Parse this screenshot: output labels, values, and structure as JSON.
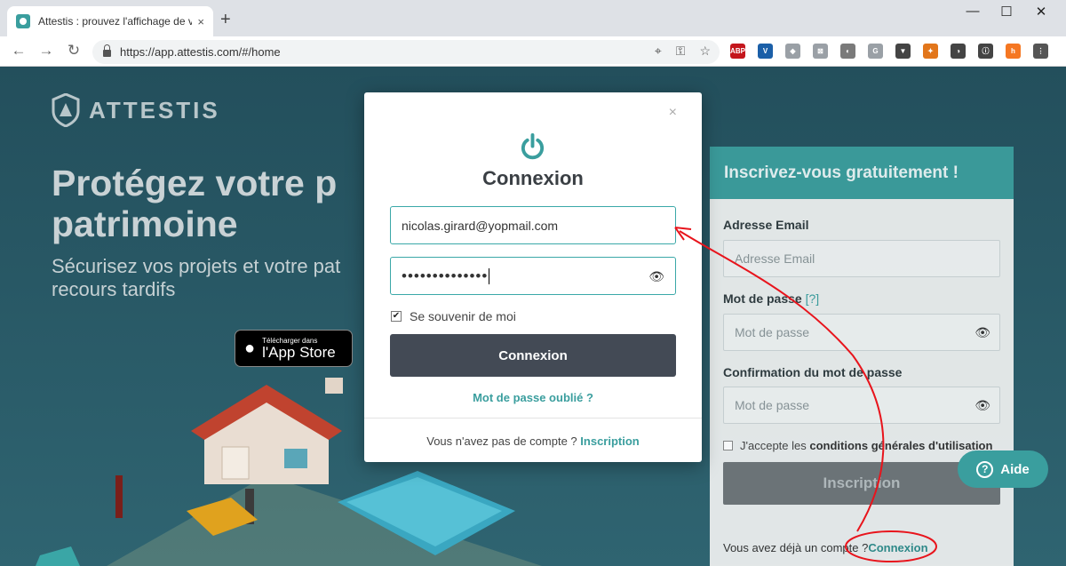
{
  "browser": {
    "tab_title": "Attestis : prouvez l'affichage de v",
    "tab_close": "×",
    "new_tab": "+",
    "url": "https://app.attestis.com/#/home",
    "window_controls": {
      "minimize": "—",
      "maximize": "☐",
      "close": "✕"
    },
    "nav": {
      "back": "←",
      "forward": "→",
      "reload": "↻"
    },
    "extensions": [
      {
        "label": "ABP",
        "color": "#c4161c"
      },
      {
        "label": "V",
        "color": "#1b5fa8"
      },
      {
        "label": "◆",
        "color": "#9aa0a6"
      },
      {
        "label": "⊠",
        "color": "#9aa0a6"
      },
      {
        "label": "◐",
        "color": "#7a7a7a"
      },
      {
        "label": "G",
        "color": "#9aa0a6"
      },
      {
        "label": "▼",
        "color": "#444444"
      },
      {
        "label": "✦",
        "color": "#e2761b"
      },
      {
        "label": "◑",
        "color": "#444444"
      },
      {
        "label": "ⓘ",
        "color": "#444444"
      },
      {
        "label": "h",
        "color": "#f57722"
      },
      {
        "label": "⋮",
        "color": "#555555"
      }
    ]
  },
  "site": {
    "logo_text": "ATTESTIS",
    "hero_title_line1": "Protégez votre p",
    "hero_title_line2": "patrimoine",
    "hero_sub_line1": "Sécurisez vos projets et votre pat",
    "hero_sub_line2": "recours tardifs",
    "appstore_small": "Télécharger dans",
    "appstore_big": "l'App Store"
  },
  "signup": {
    "heading": "Inscrivez-vous gratuitement !",
    "email_label": "Adresse Email",
    "email_placeholder": "Adresse Email",
    "password_label": "Mot de passe",
    "password_help": "[?]",
    "password_placeholder": "Mot de passe",
    "confirm_label": "Confirmation du mot de passe",
    "confirm_placeholder": "Mot de passe",
    "terms_prefix": "J'accepte les",
    "terms_link": "conditions générales d'utilisation",
    "submit": "Inscription",
    "footer_text": "Vous avez déjà un compte ?",
    "footer_link": "Connexion"
  },
  "help_button": {
    "icon": "?",
    "label": "Aide"
  },
  "login_modal": {
    "close": "×",
    "title": "Connexion",
    "email_value": "nicolas.girard@yopmail.com",
    "password_value": "••••••••••••••",
    "remember_label": "Se souvenir de moi",
    "remember_checked": "✔",
    "submit": "Connexion",
    "forgot": "Mot de passe oublié ?",
    "footer_text": "Vous n'avez pas de compte ?",
    "footer_link": "Inscription"
  },
  "colors": {
    "accent": "#3a9e9e",
    "modal_button": "#434a55",
    "annotation": "#e8141c"
  }
}
